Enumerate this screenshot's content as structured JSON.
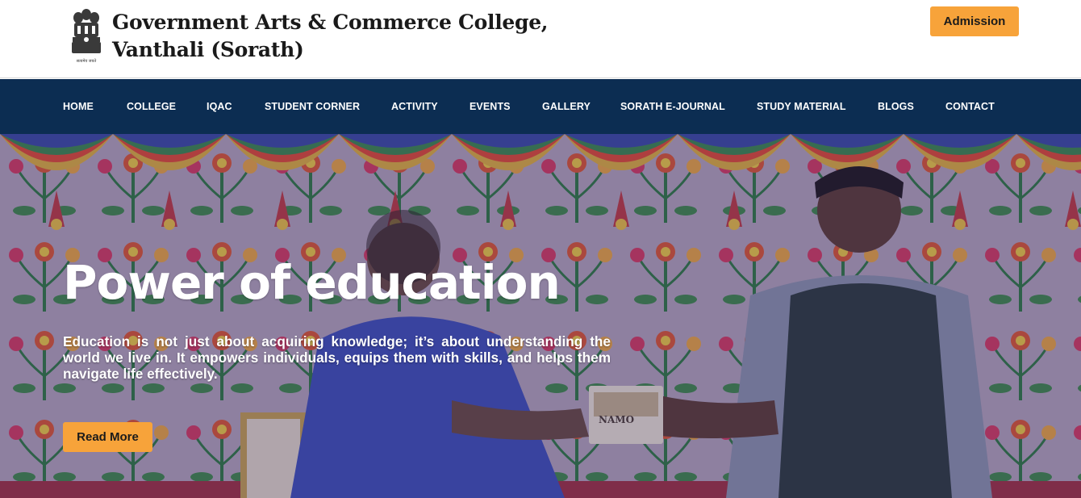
{
  "header": {
    "college_name_line1": "Government Arts & Commerce College,",
    "college_name_line2": "Vanthali (Sorath)",
    "emblem_caption": "सत्यमेव जयते",
    "admission_label": "Admission"
  },
  "nav": {
    "items": [
      {
        "label": "HOME"
      },
      {
        "label": "COLLEGE"
      },
      {
        "label": "IQAC"
      },
      {
        "label": "STUDENT CORNER"
      },
      {
        "label": "ACTIVITY"
      },
      {
        "label": "EVENTS"
      },
      {
        "label": "GALLERY"
      },
      {
        "label": "SORATH E-JOURNAL"
      },
      {
        "label": "STUDY MATERIAL"
      },
      {
        "label": "BLOGS"
      },
      {
        "label": "CONTACT"
      }
    ]
  },
  "hero": {
    "title": "Power of education",
    "text": "Education is not just about acquiring knowledge; it’s about understanding the world we live in. It empowers individuals, equips them with skills, and helps them navigate life effectively.",
    "button_label": "Read More",
    "book_label": "NAMO"
  },
  "colors": {
    "nav_background": "#0c2d52",
    "accent": "#f7a33a",
    "hero_overlay": "#2d286e"
  }
}
